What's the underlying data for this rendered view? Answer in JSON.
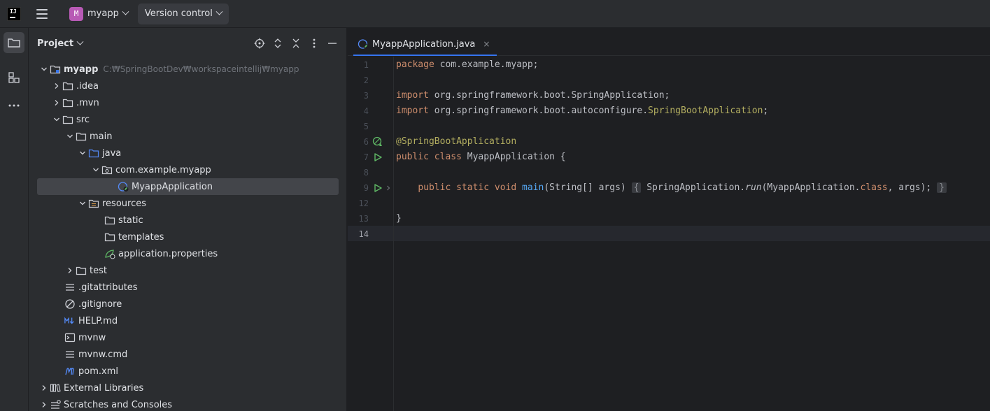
{
  "titlebar": {
    "project_badge": "M",
    "project_name": "myapp",
    "vcs_label": "Version control"
  },
  "colors": {
    "accent": "#3574f0",
    "project_badge": "#b85ab5",
    "keyword": "#cf8e6d",
    "annotation": "#b3ae60",
    "function": "#56a8f5",
    "run_gutter": "#5fb865"
  },
  "project_panel": {
    "title": "Project",
    "tree": [
      {
        "label": "myapp",
        "path": "C:₩SpringBootDev₩workspaceintellij₩myapp",
        "icon": "module-folder-icon",
        "expanded": true
      },
      {
        "label": ".idea",
        "icon": "folder-icon",
        "expanded": false
      },
      {
        "label": ".mvn",
        "icon": "folder-icon",
        "expanded": false
      },
      {
        "label": "src",
        "icon": "folder-icon",
        "expanded": true
      },
      {
        "label": "main",
        "icon": "folder-icon",
        "expanded": true
      },
      {
        "label": "java",
        "icon": "source-folder-icon",
        "expanded": true
      },
      {
        "label": "com.example.myapp",
        "icon": "package-icon",
        "expanded": true
      },
      {
        "label": "MyappApplication",
        "icon": "spring-class-icon",
        "selected": true
      },
      {
        "label": "resources",
        "icon": "resources-folder-icon",
        "expanded": true
      },
      {
        "label": "static",
        "icon": "folder-icon"
      },
      {
        "label": "templates",
        "icon": "folder-icon"
      },
      {
        "label": "application.properties",
        "icon": "spring-properties-icon"
      },
      {
        "label": "test",
        "icon": "folder-icon",
        "expanded": false
      },
      {
        "label": ".gitattributes",
        "icon": "text-file-icon"
      },
      {
        "label": ".gitignore",
        "icon": "ignore-file-icon"
      },
      {
        "label": "HELP.md",
        "icon": "markdown-icon"
      },
      {
        "label": "mvnw",
        "icon": "shell-script-icon"
      },
      {
        "label": "mvnw.cmd",
        "icon": "text-file-icon"
      },
      {
        "label": "pom.xml",
        "icon": "maven-icon"
      },
      {
        "label": "External Libraries",
        "icon": "library-icon",
        "expanded": false
      },
      {
        "label": "Scratches and Consoles",
        "icon": "scratches-icon",
        "expanded": false
      }
    ]
  },
  "editor": {
    "tab_label": "MyappApplication.java",
    "tab_close": "×",
    "line_numbers": [
      "1",
      "2",
      "3",
      "4",
      "5",
      "6",
      "7",
      "8",
      "9",
      "12",
      "13",
      "14"
    ],
    "code": {
      "l1_kw": "package",
      "l1_rest": " com.example.myapp;",
      "l3_kw": "import",
      "l3_rest": " org.springframework.boot.SpringApplication;",
      "l4_kw": "import",
      "l4_rest": " org.springframework.boot.autoconfigure.",
      "l4_ann": "SpringBootApplication",
      "l4_end": ";",
      "l6_ann": "@SpringBootApplication",
      "l7_kw": "public class",
      "l7_rest": " MyappApplication {",
      "l9_indent": "    ",
      "l9_kw": "public static void",
      "l9_sp": " ",
      "l9_fn": "main",
      "l9_args": "(String[] args)",
      "l9_fold_open": "{",
      "l9_body1": " SpringApplication.",
      "l9_run": "run",
      "l9_body2": "(MyappApplication.",
      "l9_class": "class",
      "l9_body3": ", args); ",
      "l9_fold_close": "}",
      "l13": "}"
    }
  }
}
